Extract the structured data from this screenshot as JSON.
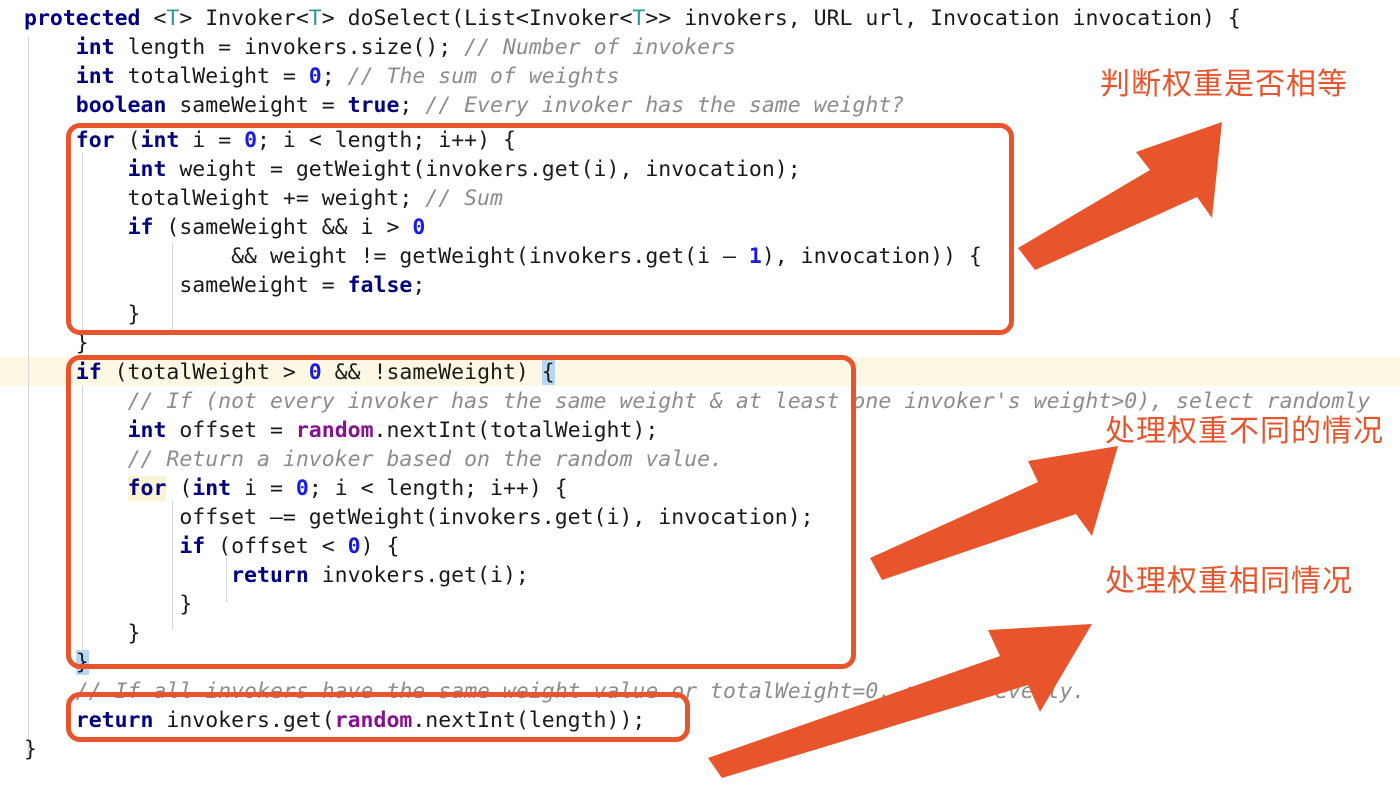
{
  "editor": {
    "language": "java",
    "background_color": "#ffffff",
    "caret_line_highlight_color": "#fdf8e4",
    "code_lines": [
      {
        "id": "l1",
        "indent": 0,
        "text": "protected <T> Invoker<T> doSelect(List<Invoker<T>> invokers, URL url, Invocation invocation) {"
      },
      {
        "id": "l2",
        "indent": 1,
        "text": "int length = invokers.size(); // Number of invokers"
      },
      {
        "id": "l3",
        "indent": 1,
        "text": "int totalWeight = 0; // The sum of weights"
      },
      {
        "id": "l4",
        "indent": 1,
        "text": "boolean sameWeight = true; // Every invoker has the same weight?"
      },
      {
        "id": "l5",
        "indent": 1,
        "text": "for (int i = 0; i < length; i++) {"
      },
      {
        "id": "l6",
        "indent": 2,
        "text": "int weight = getWeight(invokers.get(i), invocation);"
      },
      {
        "id": "l7",
        "indent": 2,
        "text": "totalWeight += weight; // Sum"
      },
      {
        "id": "l8",
        "indent": 2,
        "text": "if (sameWeight && i > 0"
      },
      {
        "id": "l9",
        "indent": 4,
        "text": "&& weight != getWeight(invokers.get(i - 1), invocation)) {"
      },
      {
        "id": "l10",
        "indent": 3,
        "text": "sameWeight = false;"
      },
      {
        "id": "l11",
        "indent": 2,
        "text": "}"
      },
      {
        "id": "l12",
        "indent": 1,
        "text": "}"
      },
      {
        "id": "l13",
        "indent": 1,
        "text": "if (totalWeight > 0 && !sameWeight) {"
      },
      {
        "id": "l14",
        "indent": 2,
        "text": "// If (not every invoker has the same weight & at least one invoker's weight>0), select randomly"
      },
      {
        "id": "l15",
        "indent": 2,
        "text": "int offset = random.nextInt(totalWeight);"
      },
      {
        "id": "l16",
        "indent": 2,
        "text": "// Return a invoker based on the random value."
      },
      {
        "id": "l17",
        "indent": 2,
        "text": "for (int i = 0; i < length; i++) {"
      },
      {
        "id": "l18",
        "indent": 3,
        "text": "offset -= getWeight(invokers.get(i), invocation);"
      },
      {
        "id": "l19",
        "indent": 3,
        "text": "if (offset < 0) {"
      },
      {
        "id": "l20",
        "indent": 4,
        "text": "return invokers.get(i);"
      },
      {
        "id": "l21",
        "indent": 3,
        "text": "}"
      },
      {
        "id": "l22",
        "indent": 2,
        "text": "}"
      },
      {
        "id": "l23",
        "indent": 1,
        "text": "}"
      },
      {
        "id": "l24",
        "indent": 1,
        "text": "// If all invokers have the same weight value or totalWeight=0, return evenly."
      },
      {
        "id": "l25",
        "indent": 1,
        "text": "return invokers.get(random.nextInt(length));"
      },
      {
        "id": "l26",
        "indent": 0,
        "text": "}"
      }
    ]
  },
  "annotations": {
    "color": "#e8552c",
    "boxes": [
      {
        "id": "box-weight-equality-check",
        "label": "for-loop weight equality box"
      },
      {
        "id": "box-different-weight-branch",
        "label": "if totalWeight branch box"
      },
      {
        "id": "box-same-weight-return",
        "label": "return invokers.get box"
      }
    ],
    "callouts": [
      {
        "id": "callout-1",
        "text": "判断权重是否相等"
      },
      {
        "id": "callout-2",
        "text": "处理权重不同的情况"
      },
      {
        "id": "callout-3",
        "text": "处理权重相同情况"
      }
    ]
  }
}
